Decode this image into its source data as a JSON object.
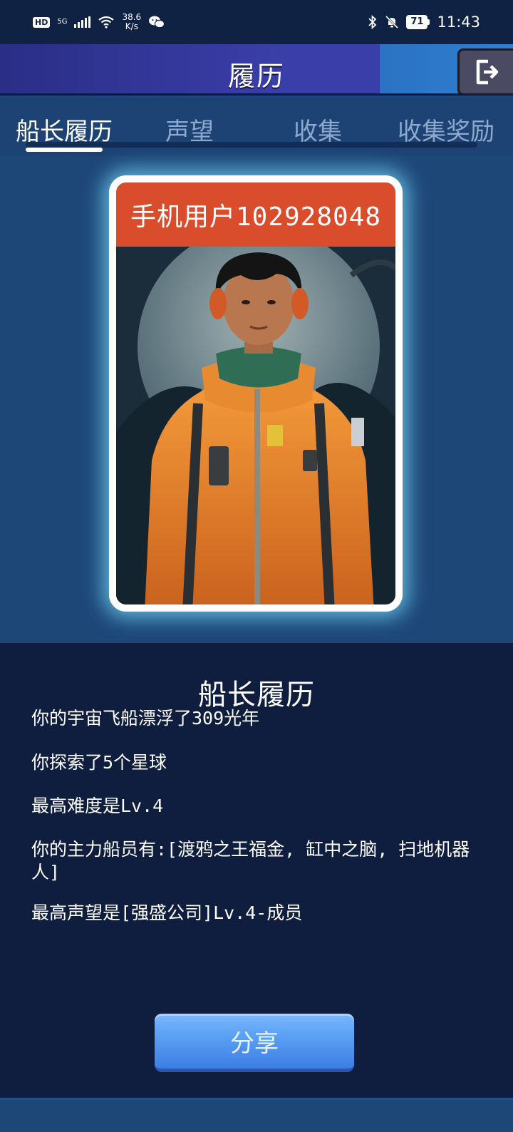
{
  "status_bar": {
    "hd": "HD",
    "network": "5G",
    "speed_value": "38.6",
    "speed_unit": "K/s",
    "battery": "71",
    "time": "11:43"
  },
  "header": {
    "title": "履历"
  },
  "tabs": [
    {
      "label": "船长履历",
      "active": true
    },
    {
      "label": "声望",
      "active": false
    },
    {
      "label": "收集",
      "active": false
    },
    {
      "label": "收集奖励",
      "active": false
    }
  ],
  "card": {
    "name": "手机用户102928048"
  },
  "resume": {
    "title": "船长履历",
    "lines": [
      "你的宇宙飞船漂浮了309光年",
      "你探索了5个星球",
      "最高难度是Lv.4",
      "你的主力船员有:[渡鸦之王福金, 缸中之脑, 扫地机器人]",
      "最高声望是[强盛公司]Lv.4-成员"
    ]
  },
  "share_button": {
    "label": "分享"
  },
  "colors": {
    "accent": "#5ba1f4",
    "name_band": "#d94d2c",
    "panel": "#0f1d3f",
    "background": "#1d4777"
  }
}
